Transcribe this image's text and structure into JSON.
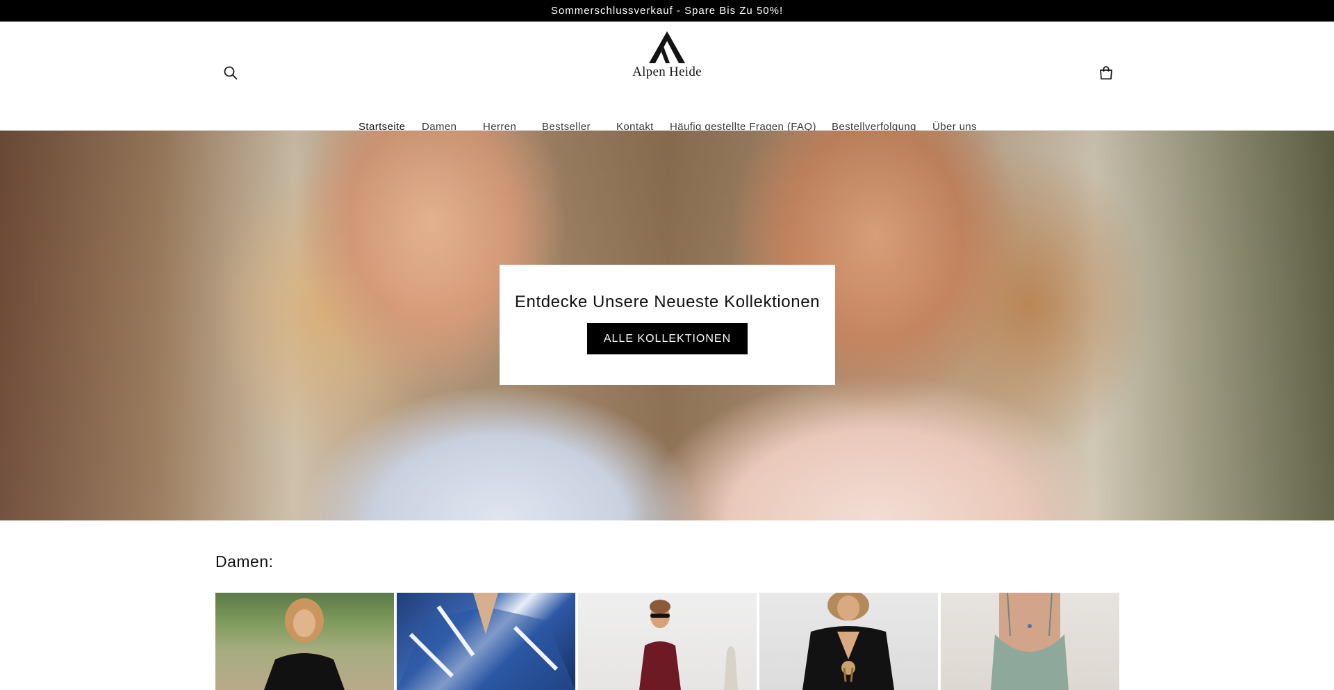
{
  "announcement": {
    "text": "Sommerschlussverkauf - Spare Bis Zu 50%!"
  },
  "header": {
    "brand_name": "Alpen Heide",
    "search_icon": "search-icon",
    "cart_icon": "cart-icon"
  },
  "nav": {
    "items": [
      {
        "label": "Startseite",
        "active": true
      },
      {
        "label": "Damen",
        "active": false
      },
      {
        "label": "Herren",
        "active": false
      },
      {
        "label": "Bestseller",
        "active": false
      },
      {
        "label": "Kontakt",
        "active": false
      },
      {
        "label": "Häufig gestellte Fragen (FAQ)",
        "active": false
      },
      {
        "label": "Bestellverfolgung",
        "active": false
      },
      {
        "label": "Über uns",
        "active": false
      }
    ]
  },
  "hero": {
    "title": "Entdecke Unsere Neueste Kollektionen",
    "button_label": "ALLE KOLLEKTIONEN"
  },
  "women_section": {
    "title": "Damen:",
    "products": [
      {
        "image": "woman-black-tshirt"
      },
      {
        "image": "blue-patterned-shirt"
      },
      {
        "image": "burgundy-dress"
      },
      {
        "image": "black-v-neck-dress"
      },
      {
        "image": "sage-slip-dress"
      }
    ]
  },
  "colors": {
    "announcement_bg": "#000000",
    "button_bg": "#000000",
    "text": "#121212"
  }
}
